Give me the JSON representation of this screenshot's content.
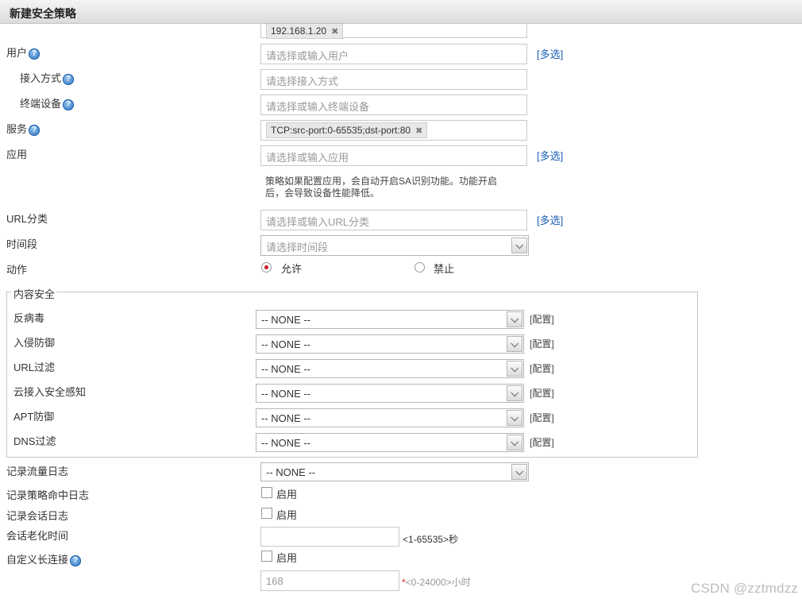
{
  "header": {
    "title": "新建安全策略"
  },
  "top_partial": {
    "tag": "192.168.1.20"
  },
  "user": {
    "label": "用户",
    "placeholder": "请选择或输入用户",
    "multi": "[多选]"
  },
  "access_mode": {
    "label": "接入方式",
    "placeholder": "请选择接入方式"
  },
  "terminal": {
    "label": "终端设备",
    "placeholder": "请选择或输入终端设备"
  },
  "service": {
    "label": "服务",
    "tag": "TCP:src-port:0-65535;dst-port:80"
  },
  "application": {
    "label": "应用",
    "placeholder": "请选择或输入应用",
    "multi": "[多选]",
    "note_line1": "策略如果配置应用，会自动开启SA识别功能。功能开启",
    "note_line2": "后，会导致设备性能降低。"
  },
  "url_category": {
    "label": "URL分类",
    "placeholder": "请选择或输入URL分类",
    "multi": "[多选]"
  },
  "time_range": {
    "label": "时间段",
    "placeholder": "请选择时间段"
  },
  "action": {
    "label": "动作",
    "allow": "允许",
    "deny": "禁止",
    "selected": "允许"
  },
  "content_security": {
    "legend": "内容安全",
    "config_label": "[配置]",
    "rows": [
      {
        "label": "反病毒",
        "value": "-- NONE --"
      },
      {
        "label": "入侵防御",
        "value": "-- NONE --"
      },
      {
        "label": "URL过滤",
        "value": "-- NONE --"
      },
      {
        "label": "云接入安全感知",
        "value": "-- NONE --"
      },
      {
        "label": "APT防御",
        "value": "-- NONE --"
      },
      {
        "label": "DNS过滤",
        "value": "-- NONE --"
      }
    ]
  },
  "traffic_log": {
    "label": "记录流量日志",
    "value": "-- NONE --"
  },
  "policy_hit_log": {
    "label": "记录策略命中日志",
    "checkbox": "启用"
  },
  "session_log": {
    "label": "记录会话日志",
    "checkbox": "启用"
  },
  "session_aging": {
    "label": "会话老化时间",
    "value": "",
    "suffix": "<1-65535>秒"
  },
  "long_connection": {
    "label": "自定义长连接",
    "checkbox": "启用",
    "value": "168",
    "required_mark": "*",
    "suffix": "<0-24000>小时"
  },
  "watermark": "CSDN @zztmdzz"
}
